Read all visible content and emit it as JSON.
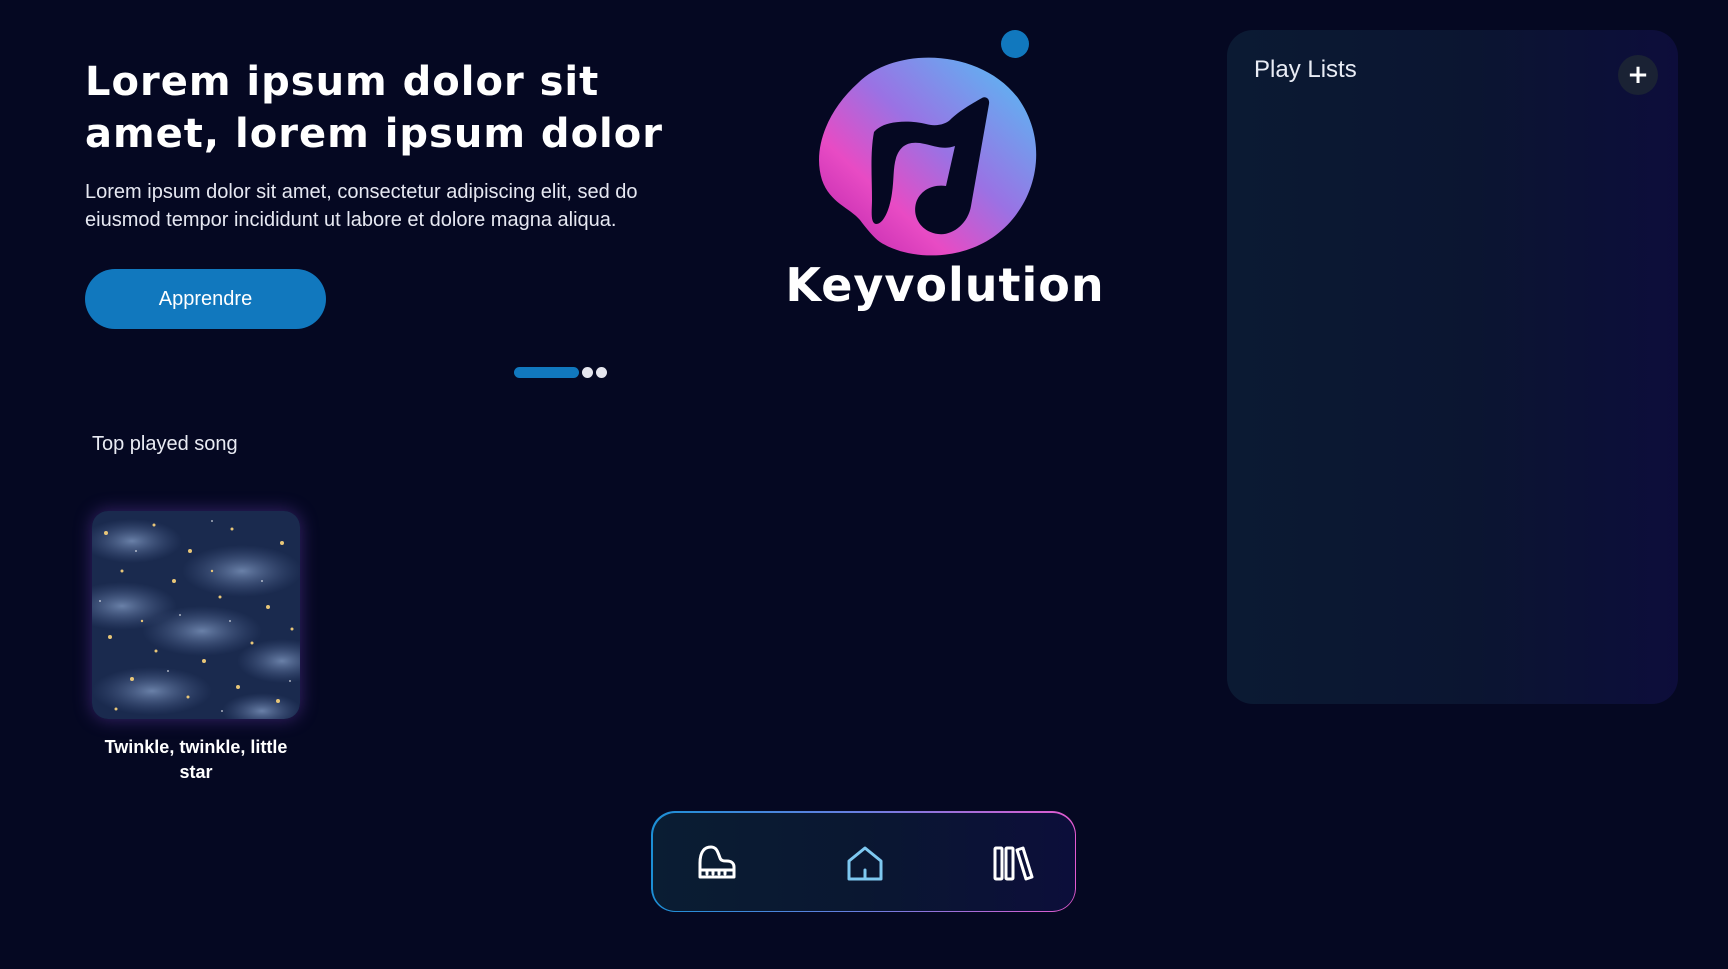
{
  "hero": {
    "title": "Lorem ipsum dolor sit amet, lorem ipsum dolor",
    "description": "Lorem ipsum dolor sit amet, consectetur adipiscing elit, sed do eiusmod tempor incididunt ut labore et dolore magna aliqua.",
    "cta_label": "Apprendre"
  },
  "carousel": {
    "slide_count": 3,
    "active_index": 0
  },
  "brand": {
    "name": "Keyvolution"
  },
  "top_played": {
    "title": "Top played song",
    "songs": [
      {
        "title": "Twinkle, twinkle, little star"
      }
    ]
  },
  "playlists": {
    "title": "Play Lists",
    "add_label": "+"
  },
  "bottom_nav": {
    "items": [
      {
        "icon": "piano-icon",
        "active": false
      },
      {
        "icon": "home-icon",
        "active": true
      },
      {
        "icon": "library-icon",
        "active": false
      }
    ]
  },
  "colors": {
    "background": "#050822",
    "accent": "#1178be",
    "active_icon": "#7ec8f0",
    "logo_gradient": [
      "#8e2bd0",
      "#e84bc4",
      "#6dc3f5"
    ]
  }
}
